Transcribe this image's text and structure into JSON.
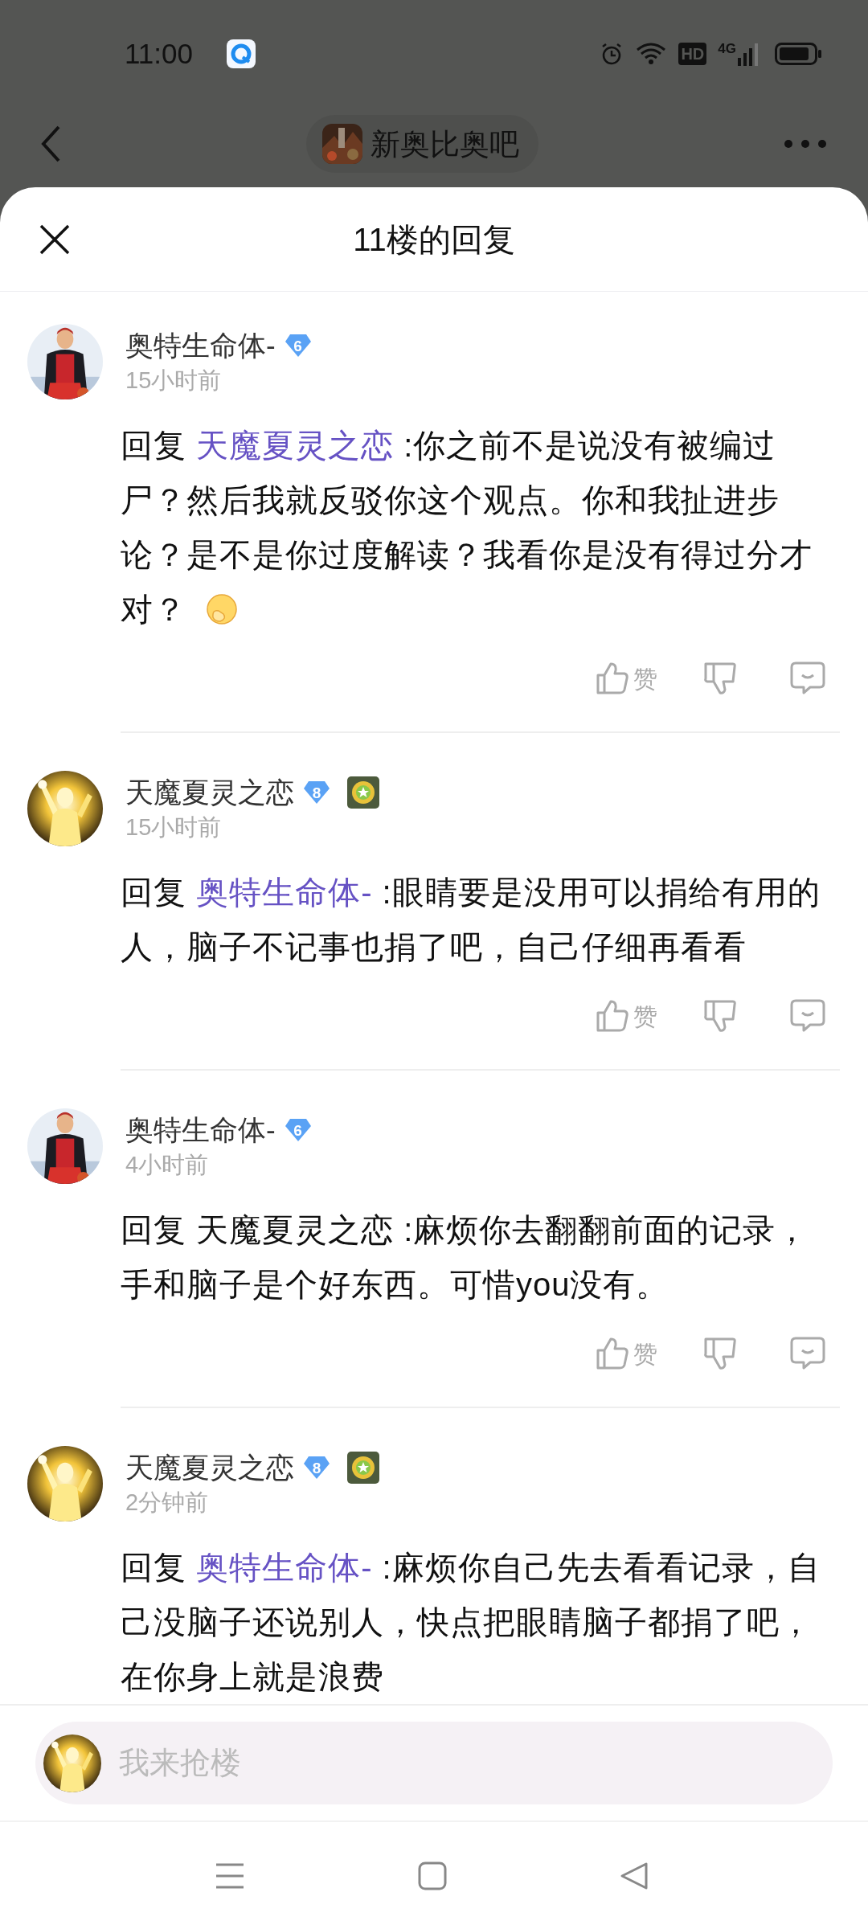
{
  "status_bar": {
    "time": "11:00",
    "hd": "HD",
    "network": "4G"
  },
  "header": {
    "forum": "新奥比奥吧"
  },
  "sheet": {
    "title": "11楼的回复"
  },
  "comments": [
    {
      "user": "奥特生命体-",
      "rank": "6",
      "medal": false,
      "time": "15小时前",
      "reply_label": "回复",
      "target": "天魔夏灵之恋",
      "target_linked": true,
      "text": ":你之前不是说没有被编过尸？然后我就反驳你这个观点。你和我扯进步论？是不是你过度解读？我看你是没有得过分才对？",
      "emoji": true,
      "actions": {
        "like": "赞"
      }
    },
    {
      "user": "天魔夏灵之恋",
      "rank": "8",
      "medal": true,
      "time": "15小时前",
      "reply_label": "回复",
      "target": "奥特生命体-",
      "target_linked": true,
      "text": ":眼睛要是没用可以捐给有用的人，脑子不记事也捐了吧，自己仔细再看看",
      "emoji": false,
      "actions": {
        "like": "赞"
      }
    },
    {
      "user": "奥特生命体-",
      "rank": "6",
      "medal": false,
      "time": "4小时前",
      "reply_label": "回复",
      "target": "天魔夏灵之恋",
      "target_linked": false,
      "text": ":麻烦你去翻翻前面的记录，手和脑子是个好东西。可惜you没有。",
      "emoji": false,
      "actions": {
        "like": "赞"
      }
    },
    {
      "user": "天魔夏灵之恋",
      "rank": "8",
      "medal": true,
      "time": "2分钟前",
      "reply_label": "回复",
      "target": "奥特生命体-",
      "target_linked": true,
      "text": ":麻烦你自己先去看看记录，自己没脑子还说别人，快点把眼睛脑子都捐了吧，在你身上就是浪费",
      "emoji": false
    }
  ],
  "composer": {
    "placeholder": "我来抢楼"
  }
}
